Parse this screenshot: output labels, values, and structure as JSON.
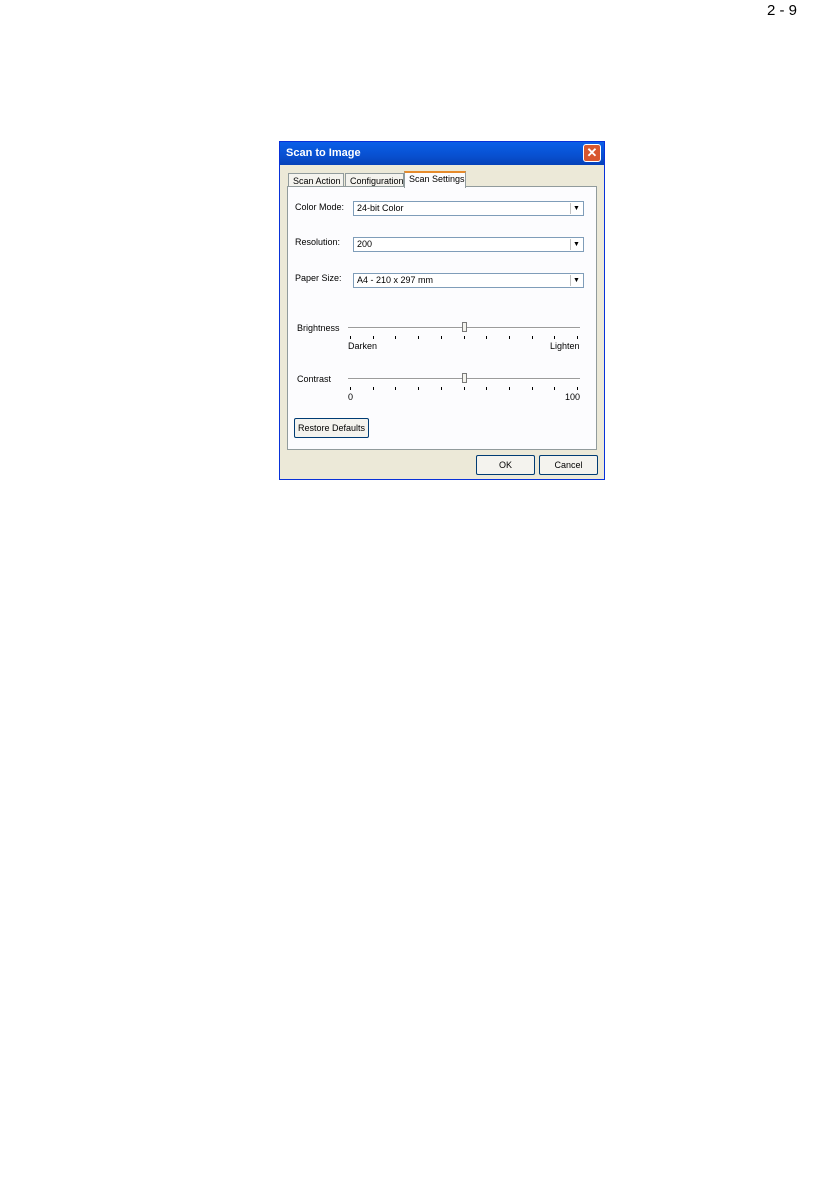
{
  "page": {
    "number": "2 - 9"
  },
  "dialog": {
    "title": "Scan to Image",
    "close_icon": "close-icon",
    "tabs": [
      {
        "label": "Scan Action",
        "active": false
      },
      {
        "label": "Configuration",
        "active": false
      },
      {
        "label": "Scan Settings",
        "active": true
      }
    ],
    "color_mode": {
      "label": "Color Mode:",
      "value": "24-bit Color"
    },
    "resolution": {
      "label": "Resolution:",
      "value": "200"
    },
    "paper_size": {
      "label": "Paper Size:",
      "value": "A4 - 210 x 297 mm"
    },
    "brightness": {
      "label": "Brightness",
      "min_label": "Darken",
      "max_label": "Lighten",
      "value": 50
    },
    "contrast": {
      "label": "Contrast",
      "min_label": "0",
      "max_label": "100",
      "value": 50
    },
    "restore_defaults": "Restore Defaults",
    "ok": "OK",
    "cancel": "Cancel"
  }
}
